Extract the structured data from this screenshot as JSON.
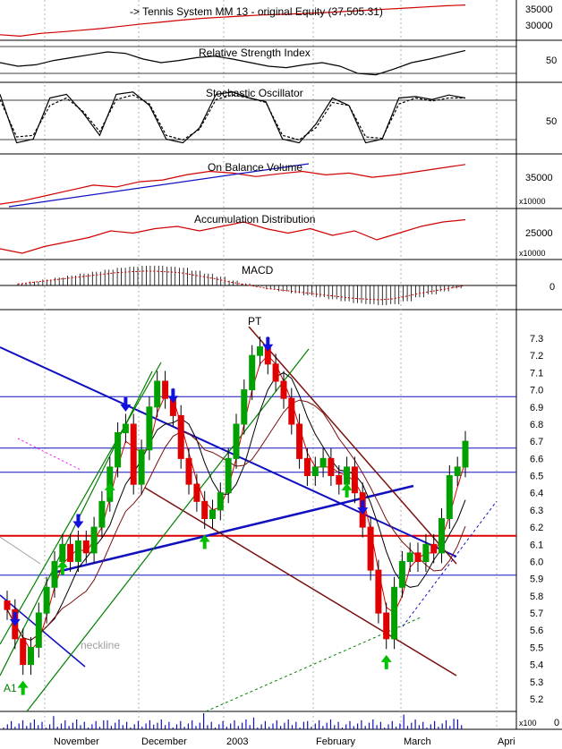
{
  "chart_data": {
    "type": "line",
    "x_axis": {
      "tick_labels": [
        "November",
        "December",
        "2003",
        "February",
        "March",
        "Apri"
      ],
      "grid": "dotted vertical"
    },
    "panels": [
      {
        "name": "equity",
        "title": "-> Tennis System MM 13 - original Equity (37,505.31)",
        "ticks": [
          "35000",
          "30000"
        ],
        "series": [
          {
            "color": "#d00000",
            "values": [
              27000,
              26500,
              27500,
              28000,
              28600,
              29200,
              30000,
              30800,
              31500,
              32200,
              32800,
              33200,
              33600,
              34000,
              34200,
              34500,
              34800,
              35200,
              35600,
              36000,
              36400,
              36800,
              37200,
              37505
            ]
          }
        ]
      },
      {
        "name": "rsi",
        "title": "Relative Strength Index",
        "ticks": [
          "50"
        ],
        "series": [
          {
            "color": "#000000",
            "values": [
              55,
              50,
              52,
              58,
              62,
              66,
              70,
              68,
              60,
              55,
              58,
              62,
              64,
              60,
              55,
              50,
              48,
              52,
              55,
              50,
              40,
              38,
              46,
              55,
              60,
              66,
              72
            ]
          }
        ]
      },
      {
        "name": "stochastic",
        "title": "Stochastic Oscillator",
        "ticks": [
          "50"
        ],
        "series": [
          {
            "color": "#000000",
            "values": [
              85,
              20,
              25,
              80,
              85,
              60,
              30,
              85,
              88,
              70,
              25,
              20,
              40,
              85,
              88,
              80,
              75,
              25,
              20,
              45,
              80,
              70,
              20,
              25,
              80,
              82,
              78,
              84,
              80
            ]
          },
          {
            "color": "#000000",
            "dashed": true,
            "values": [
              78,
              28,
              30,
              70,
              80,
              62,
              35,
              78,
              84,
              72,
              30,
              24,
              38,
              78,
              84,
              80,
              74,
              30,
              24,
              40,
              74,
              70,
              28,
              26,
              72,
              80,
              76,
              80,
              80
            ]
          }
        ]
      },
      {
        "name": "obv",
        "title": "On Balance Volume",
        "ticks": [
          "35000"
        ],
        "unit": "x10000",
        "series": [
          {
            "color": "#d00000",
            "values": [
              27000,
              28000,
              29500,
              31000,
              32500,
              32000,
              33500,
              34000,
              35500,
              36500,
              36000,
              35000,
              35800,
              36500,
              35500,
              36000,
              34800,
              35500,
              36500,
              37500,
              38500
            ]
          }
        ]
      },
      {
        "name": "ad",
        "title": "Accumulation Distribution",
        "ticks": [
          "25000"
        ],
        "unit": "x10000",
        "series": [
          {
            "color": "#d00000",
            "values": [
              22000,
              21000,
              22500,
              23500,
              24500,
              26000,
              25500,
              26500,
              27000,
              26000,
              27000,
              28000,
              26500,
              25500,
              26500,
              25000,
              26000,
              24000,
              25500,
              27000,
              28000,
              28500
            ]
          }
        ]
      },
      {
        "name": "macd",
        "title": "MACD",
        "ticks": [
          "0"
        ],
        "histogram": [
          0.02,
          0.04,
          0.06,
          0.08,
          0.1,
          0.12,
          0.14,
          0.16,
          0.18,
          0.19,
          0.2,
          0.2,
          0.19,
          0.18,
          0.15,
          0.12,
          0.09,
          0.05,
          0.02,
          -0.01,
          -0.04,
          -0.06,
          -0.08,
          -0.1,
          -0.12,
          -0.14,
          -0.16,
          -0.18,
          -0.19,
          -0.2,
          -0.19,
          -0.16,
          -0.12,
          -0.09,
          -0.06,
          -0.03,
          0.0
        ]
      }
    ],
    "price_panel": {
      "ylim": [
        5.1,
        7.4
      ],
      "y_ticks": [
        "7.3",
        "7.2",
        "7.1",
        "7.0",
        "6.9",
        "6.8",
        "6.7",
        "6.6",
        "6.5",
        "6.4",
        "6.3",
        "6.2",
        "6.1",
        "6.0",
        "5.9",
        "5.8",
        "5.7",
        "5.6",
        "5.5",
        "5.4",
        "5.3",
        "5.2"
      ],
      "annotations": [
        "PT",
        "neckline",
        "A1"
      ],
      "horizontal_lines": [
        {
          "value": 6.96,
          "color": "#1010c0"
        },
        {
          "value": 6.66,
          "color": "#1010c0"
        },
        {
          "value": 6.52,
          "color": "#1010c0"
        },
        {
          "value": 6.15,
          "color": "#e00000"
        },
        {
          "value": 5.92,
          "color": "#1010c0"
        }
      ],
      "close": [
        5.72,
        5.55,
        5.4,
        5.5,
        5.7,
        5.85,
        6.0,
        6.1,
        6.0,
        6.12,
        6.05,
        6.2,
        6.35,
        6.55,
        6.75,
        6.8,
        6.45,
        6.65,
        6.9,
        7.05,
        6.95,
        6.85,
        6.6,
        6.45,
        6.35,
        6.25,
        6.3,
        6.4,
        6.6,
        6.8,
        7.0,
        7.2,
        7.25,
        7.15,
        7.05,
        6.95,
        6.8,
        6.6,
        6.5,
        6.55,
        6.6,
        6.5,
        6.45,
        6.55,
        6.4,
        6.2,
        5.95,
        5.7,
        5.55,
        5.85,
        6.0,
        6.05,
        6.0,
        6.1,
        6.05,
        6.25,
        6.5,
        6.55,
        6.7
      ]
    },
    "volume_panel": {
      "ticks": [
        "0"
      ],
      "unit": "x100"
    }
  }
}
